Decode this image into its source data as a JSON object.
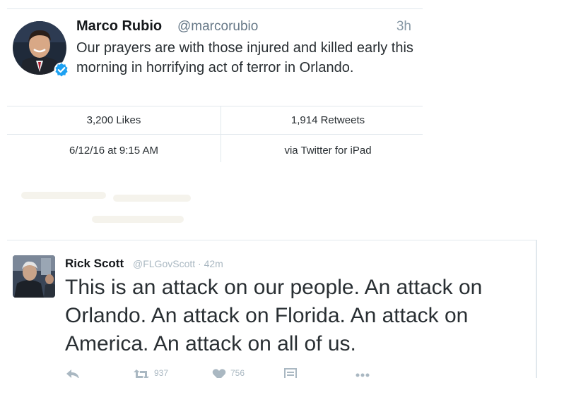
{
  "tweet1": {
    "display_name": "Marco Rubio",
    "handle": "@marcorubio",
    "time": "3h",
    "text": "Our prayers are with those injured and killed early this morning in horrifying act of terror in Orlando.",
    "likes": "3,200 Likes",
    "retweets": "1,914 Retweets",
    "timestamp": "6/12/16 at 9:15 AM",
    "source": "via Twitter for iPad",
    "verified_icon": "verified-badge-icon",
    "verified_color": "#1da1f2"
  },
  "tweet2": {
    "display_name": "Rick Scott",
    "handle": "@FLGovScott",
    "time": "· 42m",
    "text": "This is an attack on our people. An attack on Orlando. An attack on Florida. An attack on America. An attack on all of us.",
    "retweet_count": "937",
    "like_count": "756",
    "icons": [
      "reply-icon",
      "retweet-icon",
      "like-icon",
      "stats-icon",
      "more-icon"
    ]
  }
}
